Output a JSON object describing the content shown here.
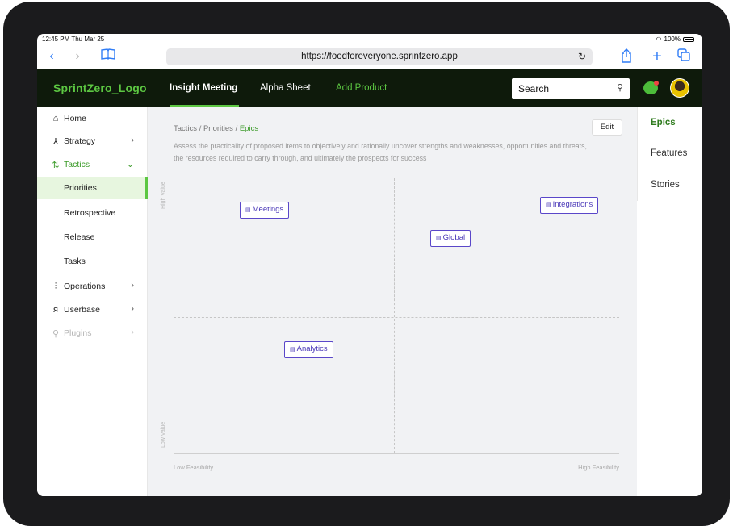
{
  "statusbar": {
    "time": "12:45 PM  Thu Mar 25",
    "battery": "100%"
  },
  "browser": {
    "url": "https://foodforeveryone.sprintzero.app"
  },
  "navbar": {
    "logo": "SprintZero_Logo",
    "links": [
      "Insight Meeting",
      "Alpha Sheet",
      "Add Product"
    ],
    "search_placeholder": "Search"
  },
  "sidebar": {
    "items": [
      {
        "icon": "home-icon",
        "label": "Home"
      },
      {
        "icon": "strategy-icon",
        "label": "Strategy"
      },
      {
        "icon": "tactics-icon",
        "label": "Tactics"
      },
      {
        "label": "Priorities"
      },
      {
        "label": "Retrospective"
      },
      {
        "label": "Release"
      },
      {
        "label": "Tasks"
      },
      {
        "icon": "operations-icon",
        "label": "Operations"
      },
      {
        "icon": "userbase-icon",
        "label": "Userbase"
      },
      {
        "icon": "plugins-icon",
        "label": "Plugins"
      }
    ]
  },
  "main": {
    "breadcrumb": [
      "Tactics",
      "Priorities",
      "Epics"
    ],
    "edit_label": "Edit",
    "description": "Assess the practicality of proposed items to objectively and rationally uncover strengths and weaknesses, opportunities and threats, the resources required to carry through, and ultimately the prospects for success",
    "matrix": {
      "y_high": "High Value",
      "y_low": "Low Value",
      "x_low": "Low Feasibility",
      "x_high": "High Feasibility",
      "items": [
        "Meetings",
        "Integrations",
        "Global",
        "Analytics"
      ]
    }
  },
  "right_panel": {
    "tabs": [
      "Epics",
      "Features",
      "Stories"
    ]
  },
  "colors": {
    "brand_green": "#5cc742",
    "navbar_bg": "#0e1a0b",
    "tag_purple": "#5a47c9"
  }
}
